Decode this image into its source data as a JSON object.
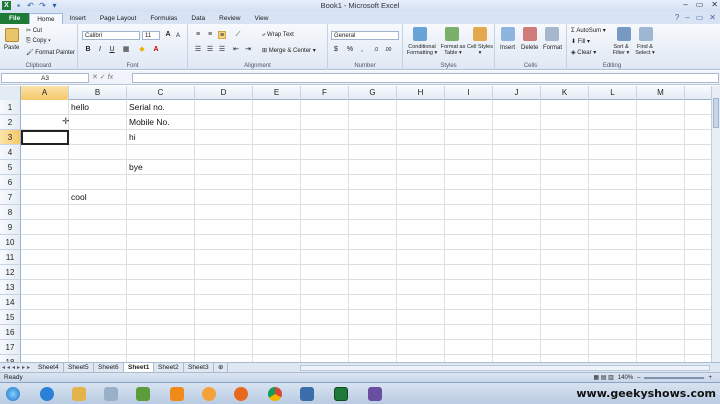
{
  "window": {
    "title": "Book1 - Microsoft Excel",
    "qat": [
      "S",
      "↶",
      "↷",
      "▾"
    ],
    "controls": [
      "–",
      "▭",
      "✕"
    ]
  },
  "ribbon_tabs": [
    "File",
    "Home",
    "Insert",
    "Page Layout",
    "Formulas",
    "Data",
    "Review",
    "View"
  ],
  "clipboard": {
    "paste": "Paste",
    "cut": "Cut",
    "copy": "Copy ▾",
    "format_painter": "Format Painter",
    "label": "Clipboard"
  },
  "font": {
    "name": "Calibri",
    "size": "11",
    "grow": "A",
    "shrink": "A",
    "bold": "B",
    "italic": "I",
    "underline": "U",
    "label": "Font"
  },
  "alignment": {
    "wrap_text": "Wrap Text",
    "merge": "Merge & Center ▾",
    "label": "Alignment"
  },
  "number": {
    "format": "General",
    "currency": "$",
    "percent": "%",
    "comma": ",",
    "label": "Number"
  },
  "styles": {
    "conditional": "Conditional Formatting ▾",
    "format_table": "Format as Table ▾",
    "cell_styles": "Cell Styles ▾",
    "label": "Styles"
  },
  "cells": {
    "insert": "Insert",
    "delete": "Delete",
    "format": "Format",
    "label": "Cells"
  },
  "editing": {
    "autosum": "AutoSum ▾",
    "fill": "Fill ▾",
    "clear": "Clear ▾",
    "sort": "Sort & Filter ▾",
    "find": "Find & Select ▾",
    "label": "Editing"
  },
  "formula_bar": {
    "name_box": "A3",
    "fx": "fx",
    "value": ""
  },
  "columns": [
    "A",
    "B",
    "C",
    "D",
    "E",
    "F",
    "G",
    "H",
    "I",
    "J",
    "K",
    "L",
    "M"
  ],
  "rows": [
    "1",
    "2",
    "3",
    "4",
    "5",
    "6",
    "7",
    "8",
    "9",
    "10",
    "11",
    "12",
    "13",
    "14",
    "15",
    "16",
    "17",
    "18"
  ],
  "cells_data": {
    "B1": "hello",
    "C1": "Serial no.",
    "C2": "Mobile No.",
    "C3": "hi",
    "C5": "bye",
    "B7": "cool"
  },
  "selected_cell": "A3",
  "sheets": [
    "Sheet4",
    "Sheet5",
    "Sheet6",
    "Sheet1",
    "Sheet2",
    "Sheet3"
  ],
  "active_sheet": "Sheet1",
  "status": {
    "ready": "Ready",
    "zoom": "140%"
  },
  "watermark": "www.geekyshows.com",
  "colors": {
    "file_tab": "#1e7b37",
    "selection": "#f5c86a"
  }
}
